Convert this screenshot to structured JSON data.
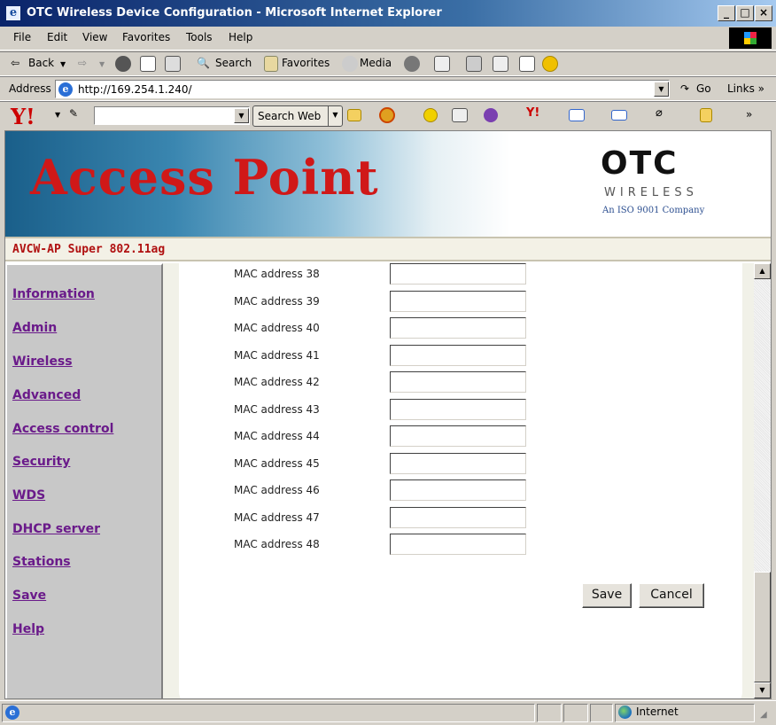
{
  "window": {
    "title": "OTC Wireless Device Configuration - Microsoft Internet Explorer",
    "buttons": [
      "_",
      "□",
      "×"
    ]
  },
  "menu": [
    "File",
    "Edit",
    "View",
    "Favorites",
    "Tools",
    "Help"
  ],
  "toolbar": {
    "back": "Back",
    "search": "Search",
    "favorites": "Favorites",
    "media": "Media"
  },
  "address": {
    "label": "Address",
    "url": "http://169.254.1.240/",
    "go": "Go",
    "links": "Links »"
  },
  "yahoo": {
    "logo": "Y!",
    "search_button": "Search Web",
    "more": "»"
  },
  "banner": {
    "headline": "Access Point",
    "logo_name": "OTC",
    "logo_tagline": "WIRELESS",
    "logo_iso": "An ISO 9001 Company"
  },
  "model": "AVCW-AP Super 802.11ag",
  "nav": [
    {
      "label": "Information"
    },
    {
      "label": "Admin"
    },
    {
      "label": "Wireless"
    },
    {
      "label": "Advanced"
    },
    {
      "label": "Access control"
    },
    {
      "label": "Security"
    },
    {
      "label": "WDS"
    },
    {
      "label": "DHCP server"
    },
    {
      "label": "Stations"
    },
    {
      "label": "Save"
    },
    {
      "label": "Help"
    }
  ],
  "mac_rows": [
    {
      "label": "MAC address 38",
      "value": ""
    },
    {
      "label": "MAC address 39",
      "value": ""
    },
    {
      "label": "MAC address 40",
      "value": ""
    },
    {
      "label": "MAC address 41",
      "value": ""
    },
    {
      "label": "MAC address 42",
      "value": ""
    },
    {
      "label": "MAC address 43",
      "value": ""
    },
    {
      "label": "MAC address 44",
      "value": ""
    },
    {
      "label": "MAC address 45",
      "value": ""
    },
    {
      "label": "MAC address 46",
      "value": ""
    },
    {
      "label": "MAC address 47",
      "value": ""
    },
    {
      "label": "MAC address 48",
      "value": ""
    }
  ],
  "actions": {
    "save": "Save",
    "cancel": "Cancel"
  },
  "status": {
    "zone": "Internet"
  }
}
